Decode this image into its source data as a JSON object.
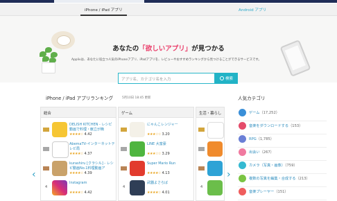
{
  "platform_tabs": {
    "ios": "iPhone / iPad アプリ",
    "android": "Android アプリ"
  },
  "hero": {
    "title_pre": "あなたの",
    "title_highlight": "「欲しいアプリ」",
    "title_post": "が見つかる",
    "description": "Applivは、あなたに役立つ人気のiPhoneアプリ、iPadアプリを、レビューやおすすめランキングから見つけることができるサービスです。",
    "search_placeholder": "アプリ名、カテゴリ名を入力",
    "search_button": "検索"
  },
  "ranking": {
    "title": "iPhone / iPad アプリランキング",
    "date": "5月10日 18:45 更新",
    "panels": [
      {
        "label": "総合",
        "apps": [
          {
            "rank": "1",
            "name": "DELISH KITCHEN - レシピ動画で料理・献立が簡",
            "stars": "★★★★☆",
            "score": "4.42",
            "icon": "delish"
          },
          {
            "rank": "2",
            "name": "AbemaTV-インターネットテレビ局",
            "stars": "★★★★☆",
            "score": "4.37",
            "icon": "abema"
          },
          {
            "rank": "3",
            "name": "kurashiru [クラシル] - レシピ動画No.1料理動画ア",
            "stars": "★★★★☆",
            "score": "4.39",
            "icon": "kurashiru"
          },
          {
            "rank": "4",
            "name": "Instagram",
            "stars": "★★★★☆",
            "score": "4.42",
            "icon": "instagram"
          }
        ]
      },
      {
        "label": "ゲーム",
        "apps": [
          {
            "rank": "1",
            "name": "にゃんこレンジャー",
            "stars": "★★★☆☆",
            "score": "3.20",
            "icon": "nyanko"
          },
          {
            "rank": "2",
            "name": "LINE 大富豪",
            "stars": "★★★☆☆",
            "score": "3.29",
            "icon": "line"
          },
          {
            "rank": "3",
            "name": "Super Mario Run",
            "stars": "★★★★☆",
            "score": "4.13",
            "icon": "mario"
          },
          {
            "rank": "4",
            "name": "武器よさらば",
            "stars": "★★★★☆",
            "score": "4.01",
            "icon": "buki"
          }
        ]
      },
      {
        "label": "生活・暮らし",
        "apps": [
          {
            "rank": "1",
            "name": "",
            "stars": "",
            "score": "",
            "icon": "life1"
          },
          {
            "rank": "2",
            "name": "",
            "stars": "",
            "score": "",
            "icon": "life2"
          },
          {
            "rank": "3",
            "name": "",
            "stars": "",
            "score": "",
            "icon": "life3"
          },
          {
            "rank": "4",
            "name": "",
            "stars": "",
            "score": "",
            "icon": "life4"
          }
        ]
      }
    ],
    "prev_arrow": "‹",
    "next_arrow": "›"
  },
  "categories": {
    "title": "人気カテゴリ",
    "items": [
      {
        "label": "ゲーム",
        "count": "（17,252）",
        "color": "#3a8fd8"
      },
      {
        "label": "音楽をダウンロードする",
        "count": "（153）",
        "color": "#e44b6a"
      },
      {
        "label": "RPG",
        "count": "（1,785）",
        "color": "#6a7fd6"
      },
      {
        "label": "出会い",
        "count": "（267）",
        "color": "#f07aa0"
      },
      {
        "label": "カメラ（写真・画像）",
        "count": "（759）",
        "color": "#35b9d1"
      },
      {
        "label": "複数の写真を編集・合成する",
        "count": "（213）",
        "color": "#7ac443"
      },
      {
        "label": "音楽プレーヤー",
        "count": "（151）",
        "color": "#ef5d5d"
      }
    ]
  }
}
